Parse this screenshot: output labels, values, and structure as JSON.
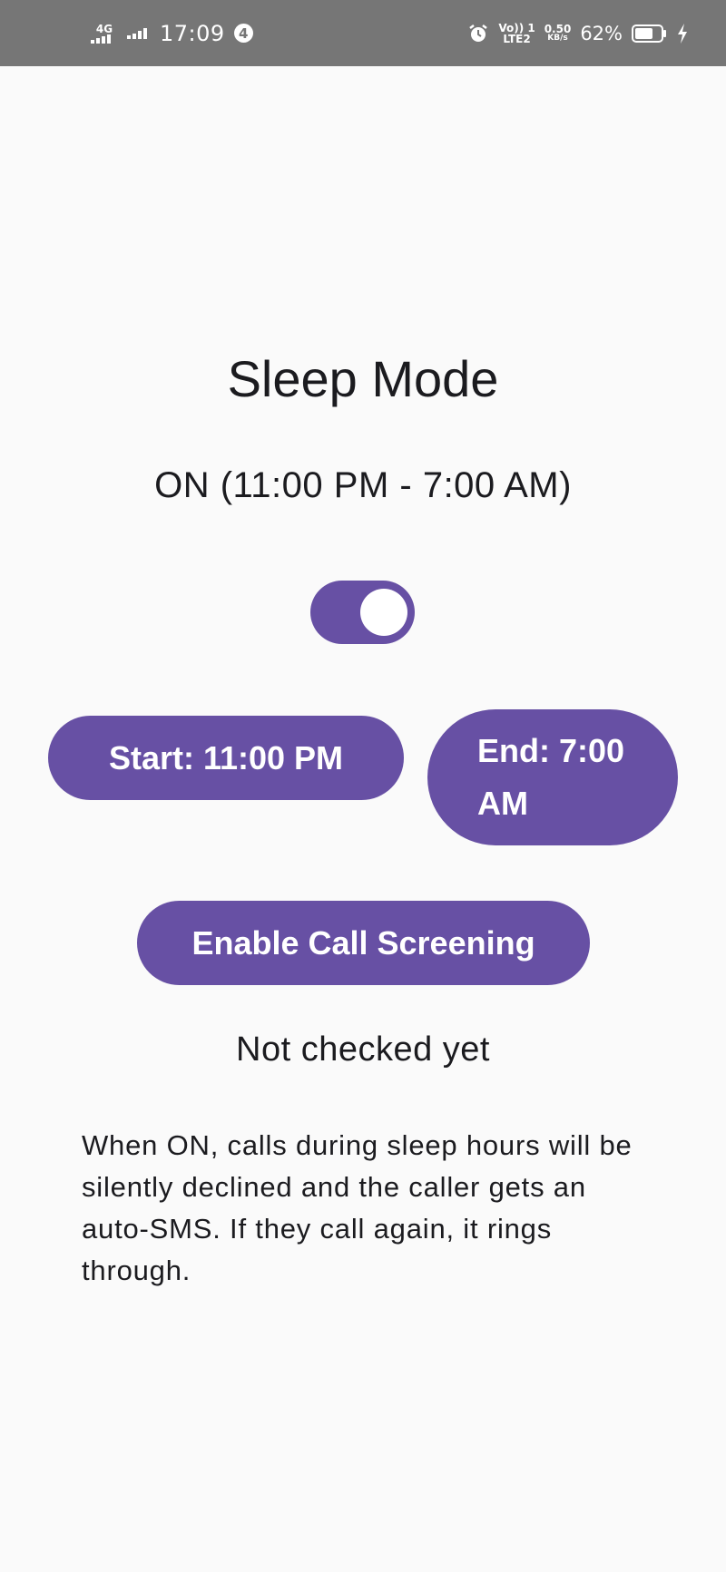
{
  "status_bar": {
    "network_type": "4G",
    "time": "17:09",
    "notification_count": "4",
    "volte_top": "Vo)) 1",
    "volte_bottom": "LTE2",
    "speed_value": "0.50",
    "speed_unit": "KB/s",
    "battery_percent": "62%"
  },
  "sleep_mode": {
    "title": "Sleep Mode",
    "status": "ON (11:00 PM - 7:00 AM)",
    "enabled": true
  },
  "schedule": {
    "start_label": "Start: 11:00 PM",
    "end_label": "End: 7:00 AM"
  },
  "call_screening": {
    "button_label": "Enable Call Screening",
    "status": "Not checked yet"
  },
  "description": "When ON, calls during sleep hours will be silently declined and the caller gets an auto-SMS. If they call again, it rings through.",
  "colors": {
    "accent": "#6750a4",
    "status_bar_bg": "#767676",
    "background": "#fafafa",
    "text": "#1b1b1f"
  }
}
